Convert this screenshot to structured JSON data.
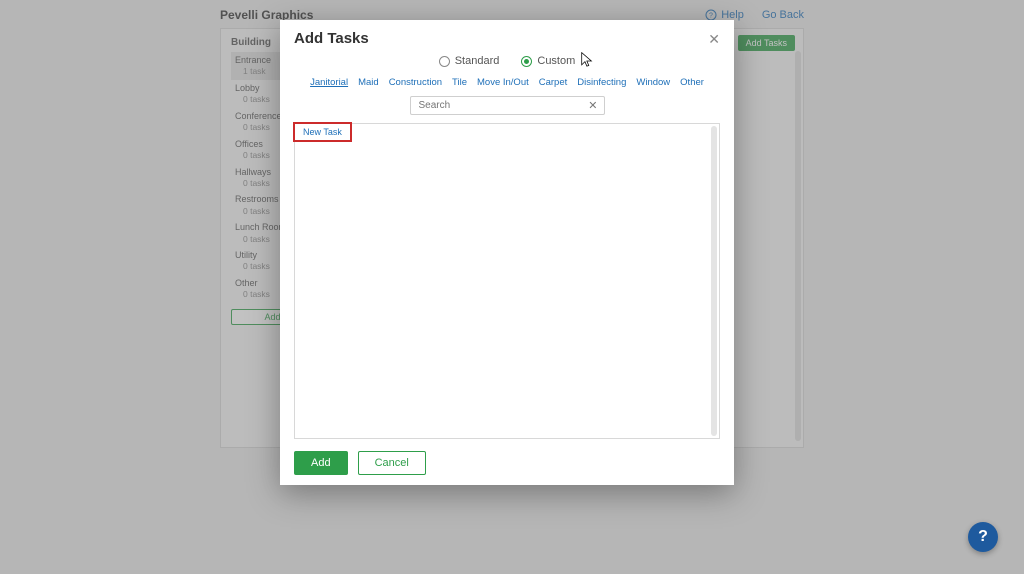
{
  "header": {
    "title": "Pevelli Graphics",
    "help_label": "Help",
    "goback_label": "Go Back"
  },
  "bg": {
    "section_label": "Building",
    "add_tasks_label": "Add Tasks",
    "add_area_label": "Add Area",
    "items": [
      {
        "name": "Entrance",
        "count": "1 task"
      },
      {
        "name": "Lobby",
        "count": "0 tasks"
      },
      {
        "name": "Conference",
        "count": "0 tasks"
      },
      {
        "name": "Offices",
        "count": "0 tasks"
      },
      {
        "name": "Hallways",
        "count": "0 tasks"
      },
      {
        "name": "Restrooms",
        "count": "0 tasks"
      },
      {
        "name": "Lunch Room",
        "count": "0 tasks"
      },
      {
        "name": "Utility",
        "count": "0 tasks"
      },
      {
        "name": "Other",
        "count": "0 tasks"
      }
    ]
  },
  "modal": {
    "title": "Add Tasks",
    "type_standard": "Standard",
    "type_custom": "Custom",
    "categories": [
      "Janitorial",
      "Maid",
      "Construction",
      "Tile",
      "Move In/Out",
      "Carpet",
      "Disinfecting",
      "Window",
      "Other"
    ],
    "active_category_index": 0,
    "search_placeholder": "Search",
    "new_task_label": "New Task",
    "add_label": "Add",
    "cancel_label": "Cancel"
  },
  "fab": {
    "label": "?"
  }
}
